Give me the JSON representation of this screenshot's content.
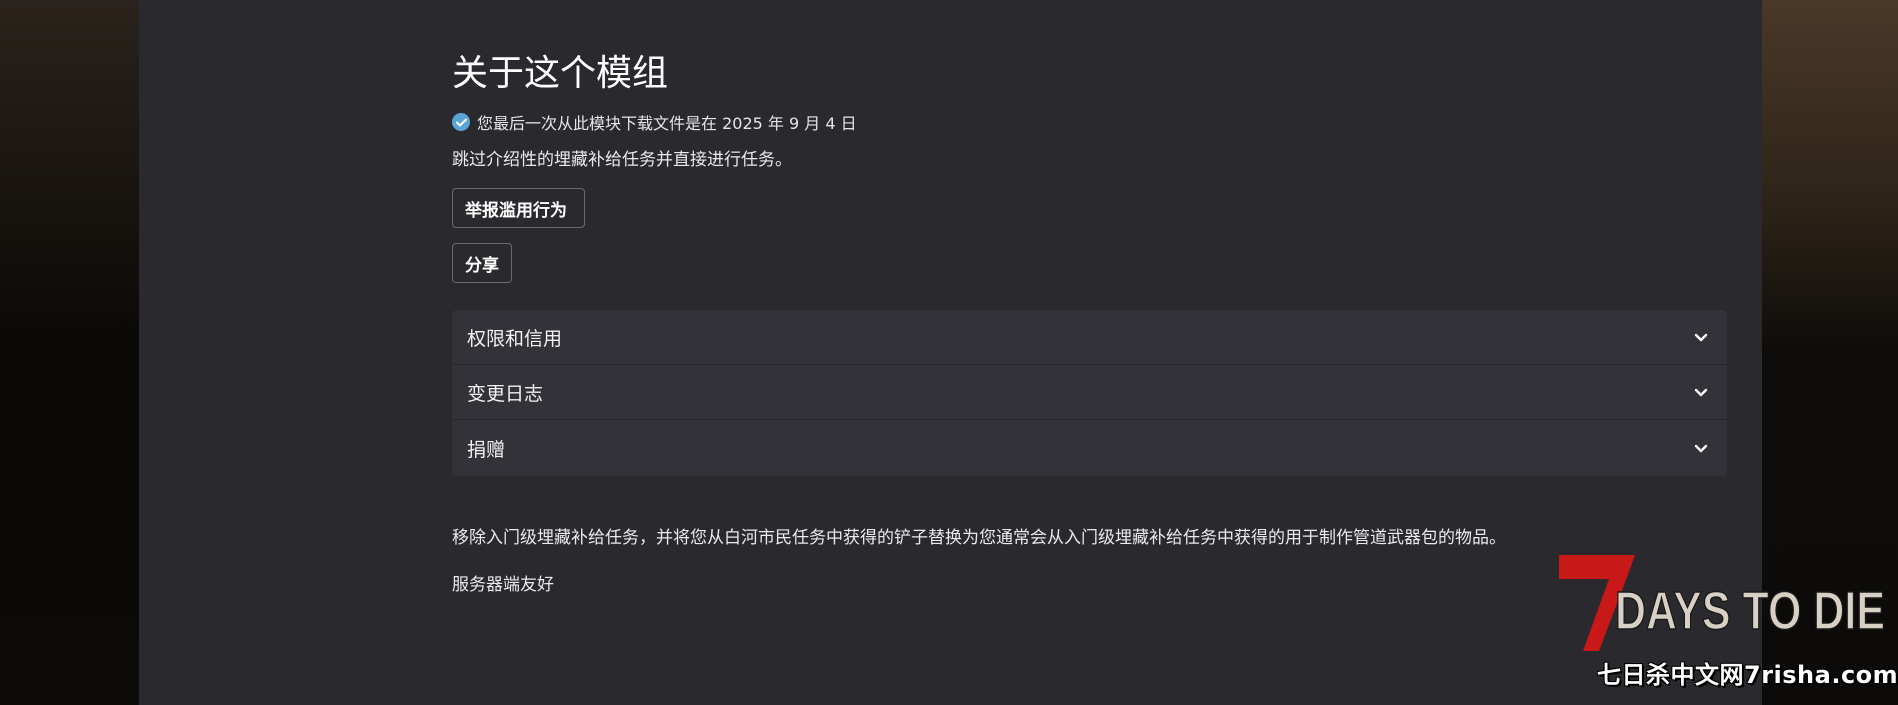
{
  "mod": {
    "section_title": "关于这个模组",
    "last_download": "您最后一次从此模块下载文件是在 2025 年 9 月 4 日",
    "summary": "跳过介绍性的埋藏补给任务并直接进行任务。",
    "report_button": "举报滥用行为",
    "share_button": "分享",
    "accordion": [
      {
        "label": "权限和信用",
        "icon": "chevron-down-icon"
      },
      {
        "label": "变更日志",
        "icon": "chevron-down-icon"
      },
      {
        "label": "捐赠",
        "icon": "chevron-down-icon"
      }
    ],
    "description": "移除入门级埋藏补给任务，并将您从白河市民任务中获得的铲子替换为您通常会从入门级埋藏补给任务中获得的用于制作管道武器包的物品。",
    "server_note": "服务器端友好"
  },
  "watermark": {
    "logo_text": "7DAYS TO DIE",
    "site_text": "七日杀中文网7risha.com"
  },
  "colors": {
    "panel_bg": "#2a2a2e",
    "accordion_bg": "#323238",
    "check_blue": "#5aa4d6",
    "logo_red": "#c81818"
  }
}
